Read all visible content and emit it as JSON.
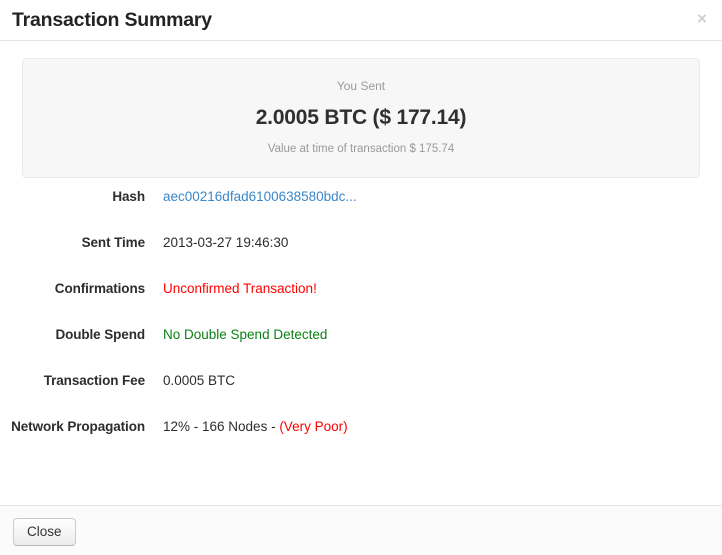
{
  "modal": {
    "title": "Transaction Summary",
    "close_icon": "close-icon",
    "close_symbol": "×"
  },
  "summary": {
    "kicker": "You Sent",
    "amount": "2.0005 BTC ($ 177.14)",
    "subvalue": "Value at time of transaction $ 175.74"
  },
  "details": {
    "hash": {
      "label": "Hash",
      "value": "aec00216dfad6100638580bdc..."
    },
    "sent_time": {
      "label": "Sent Time",
      "value": "2013-03-27 19:46:30"
    },
    "confirmations": {
      "label": "Confirmations",
      "value": "Unconfirmed Transaction!"
    },
    "double_spend": {
      "label": "Double Spend",
      "value": "No Double Spend Detected"
    },
    "transaction_fee": {
      "label": "Transaction Fee",
      "value": "0.0005 BTC"
    },
    "network_propagation": {
      "label": "Network Propagation",
      "value_main": "12% - 166 Nodes - ",
      "value_rating": "(Very Poor)"
    }
  },
  "footer": {
    "close_label": "Close"
  },
  "colors": {
    "link": "#3a87c8",
    "danger": "#ff0000",
    "success": "#0b8215",
    "panel_bg": "#f7f7f7",
    "muted_text": "#9a9a9a"
  }
}
